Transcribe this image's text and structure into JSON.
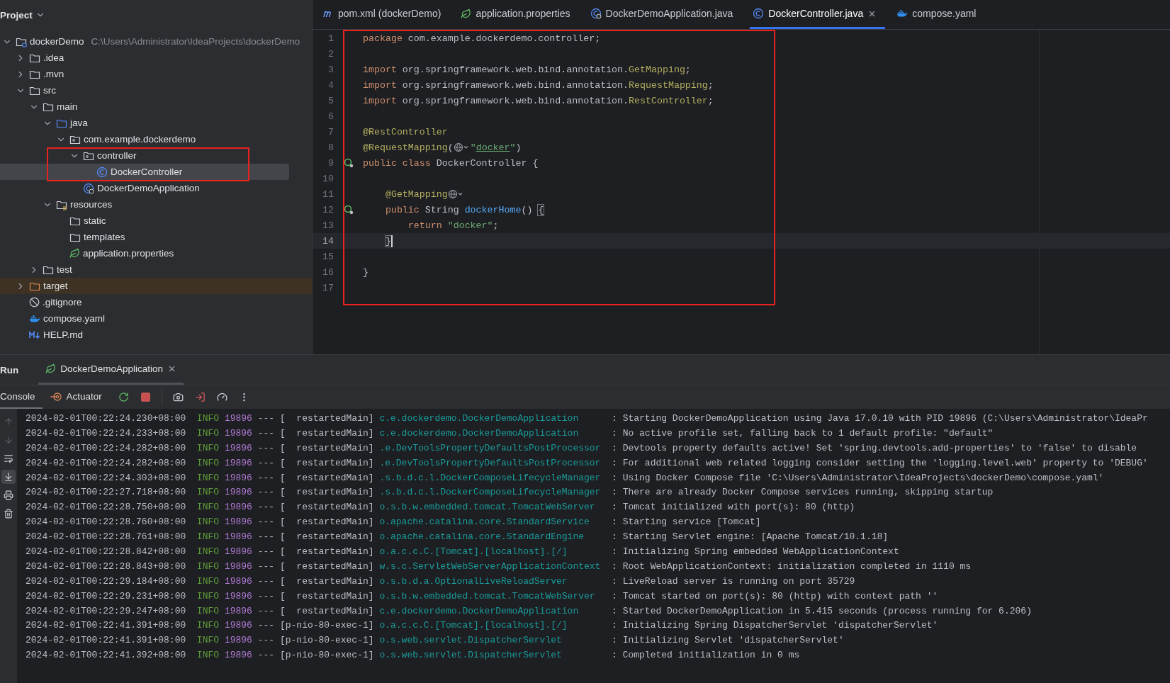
{
  "project": {
    "title": "Project",
    "tree": [
      {
        "label": "dockerDemo",
        "kind": "module",
        "path": "C:\\Users\\Administrator\\IdeaProjects\\dockerDemo",
        "expanded": true,
        "selected": false,
        "children": [
          {
            "label": ".idea",
            "kind": "folder",
            "expanded": false,
            "selected": false
          },
          {
            "label": ".mvn",
            "kind": "folder",
            "expanded": false,
            "selected": false
          },
          {
            "label": "src",
            "kind": "folder",
            "expanded": true,
            "selected": false,
            "children": [
              {
                "label": "main",
                "kind": "folder",
                "expanded": true,
                "selected": false,
                "children": [
                  {
                    "label": "java",
                    "kind": "source",
                    "expanded": true,
                    "selected": false,
                    "children": [
                      {
                        "label": "com.example.dockerdemo",
                        "kind": "package",
                        "expanded": true,
                        "selected": false,
                        "children": [
                          {
                            "label": "controller",
                            "kind": "package",
                            "expanded": true,
                            "selected": false,
                            "highlight": true,
                            "children": [
                              {
                                "label": "DockerController",
                                "kind": "class",
                                "selected": true
                              }
                            ]
                          },
                          {
                            "label": "DockerDemoApplication",
                            "kind": "spring-class",
                            "selected": false
                          }
                        ]
                      }
                    ]
                  },
                  {
                    "label": "resources",
                    "kind": "resources",
                    "expanded": true,
                    "selected": false,
                    "children": [
                      {
                        "label": "static",
                        "kind": "folder",
                        "selected": false
                      },
                      {
                        "label": "templates",
                        "kind": "folder",
                        "selected": false
                      },
                      {
                        "label": "application.properties",
                        "kind": "properties",
                        "selected": false
                      }
                    ]
                  }
                ]
              },
              {
                "label": "test",
                "kind": "folder",
                "expanded": false,
                "selected": false
              }
            ]
          },
          {
            "label": "target",
            "kind": "excluded",
            "expanded": false,
            "selected": false
          },
          {
            "label": ".gitignore",
            "kind": "ignore",
            "selected": false
          },
          {
            "label": "compose.yaml",
            "kind": "docker",
            "selected": false
          },
          {
            "label": "HELP.md",
            "kind": "markdown",
            "selected": false
          }
        ]
      }
    ]
  },
  "editor": {
    "tabs": [
      {
        "label": "pom.xml (dockerDemo)",
        "kind": "maven",
        "selected": false
      },
      {
        "label": "application.properties",
        "kind": "properties",
        "selected": false
      },
      {
        "label": "DockerDemoApplication.java",
        "kind": "spring-class",
        "selected": false
      },
      {
        "label": "DockerController.java",
        "kind": "class",
        "selected": true
      },
      {
        "label": "compose.yaml",
        "kind": "docker",
        "selected": false
      }
    ],
    "highlight": true,
    "lines": [
      {
        "number": "1",
        "current": false,
        "marker": false,
        "tokens": [
          {
            "kind": "keyword",
            "text": "package"
          },
          {
            "kind": "plain",
            "text": " com.example.dockerdemo.controller;"
          }
        ]
      },
      {
        "number": "2",
        "current": false,
        "marker": false
      },
      {
        "number": "3",
        "current": false,
        "marker": false,
        "tokens": [
          {
            "kind": "keyword",
            "text": "import"
          },
          {
            "kind": "plain",
            "text": " org.springframework.web.bind.annotation."
          },
          {
            "kind": "annotation",
            "text": "GetMapping"
          },
          {
            "kind": "plain",
            "text": ";"
          }
        ]
      },
      {
        "number": "4",
        "current": false,
        "marker": false,
        "tokens": [
          {
            "kind": "keyword",
            "text": "import"
          },
          {
            "kind": "plain",
            "text": " org.springframework.web.bind.annotation."
          },
          {
            "kind": "annotation",
            "text": "RequestMapping"
          },
          {
            "kind": "plain",
            "text": ";"
          }
        ]
      },
      {
        "number": "5",
        "current": false,
        "marker": false,
        "tokens": [
          {
            "kind": "keyword",
            "text": "import"
          },
          {
            "kind": "plain",
            "text": " org.springframework.web.bind.annotation."
          },
          {
            "kind": "annotation",
            "text": "RestController"
          },
          {
            "kind": "plain",
            "text": ";"
          }
        ]
      },
      {
        "number": "6",
        "current": false,
        "marker": false
      },
      {
        "number": "7",
        "current": false,
        "marker": false,
        "tokens": [
          {
            "kind": "annotation",
            "text": "@RestController"
          }
        ]
      },
      {
        "number": "8",
        "current": false,
        "marker": false,
        "tokens": [
          {
            "kind": "annotation",
            "text": "@RequestMapping"
          },
          {
            "kind": "plain",
            "text": "("
          },
          {
            "kind": "inlay"
          },
          {
            "kind": "string",
            "text": "\""
          },
          {
            "kind": "link",
            "text": "docker"
          },
          {
            "kind": "string",
            "text": "\""
          },
          {
            "kind": "plain",
            "text": ")"
          }
        ]
      },
      {
        "number": "9",
        "current": false,
        "marker": true,
        "tokens": [
          {
            "kind": "keyword",
            "text": "public class"
          },
          {
            "kind": "plain",
            "text": " DockerController {"
          }
        ]
      },
      {
        "number": "10",
        "current": false,
        "marker": false
      },
      {
        "number": "11",
        "current": false,
        "marker": false,
        "tokens": [
          {
            "kind": "annotation",
            "text": "    @GetMapping"
          },
          {
            "kind": "inlay"
          }
        ]
      },
      {
        "number": "12",
        "current": false,
        "marker": true,
        "tokens": [
          {
            "kind": "keyword",
            "text": "    public"
          },
          {
            "kind": "plain",
            "text": " String "
          },
          {
            "kind": "method",
            "text": "dockerHome"
          },
          {
            "kind": "plain",
            "text": "() "
          },
          {
            "kind": "brace",
            "text": "{"
          }
        ]
      },
      {
        "number": "13",
        "current": false,
        "marker": false,
        "tokens": [
          {
            "kind": "keyword",
            "text": "        return"
          },
          {
            "kind": "string",
            "text": " \"docker\""
          },
          {
            "kind": "plain",
            "text": ";"
          }
        ]
      },
      {
        "number": "14",
        "current": true,
        "marker": false,
        "tokens": [
          {
            "kind": "brace",
            "text": "    }"
          }
        ]
      },
      {
        "number": "15",
        "current": false,
        "marker": false
      },
      {
        "number": "16",
        "current": false,
        "marker": false,
        "tokens": [
          {
            "kind": "plain",
            "text": "}"
          }
        ]
      },
      {
        "number": "17",
        "current": false,
        "marker": false
      }
    ]
  },
  "run": {
    "title": "Run",
    "tabs": [
      {
        "label": "DockerDemoApplication",
        "selected": true
      }
    ],
    "toolbar_tabs": [
      {
        "label": "Console",
        "kind": "plain",
        "selected": true
      },
      {
        "label": "Actuator",
        "kind": "actuator",
        "selected": false
      }
    ],
    "console": {
      "lines": [
        {
          "time": "2024-02-01T00:22:24.230+08:00",
          "level": "INFO",
          "pid": "19896",
          "separator": "---",
          "thread": "[  restartedMain]",
          "logger": "c.e.dockerdemo.DockerDemoApplication",
          "message": ": Starting DockerDemoApplication using Java 17.0.10 with PID 19896 (C:\\Users\\Administrator\\IdeaPr"
        },
        {
          "time": "2024-02-01T00:22:24.233+08:00",
          "level": "INFO",
          "pid": "19896",
          "separator": "---",
          "thread": "[  restartedMain]",
          "logger": "c.e.dockerdemo.DockerDemoApplication",
          "message": ": No active profile set, falling back to 1 default profile: \"default\""
        },
        {
          "time": "2024-02-01T00:22:24.282+08:00",
          "level": "INFO",
          "pid": "19896",
          "separator": "---",
          "thread": "[  restartedMain]",
          "logger": ".e.DevToolsPropertyDefaultsPostProcessor",
          "message": ": Devtools property defaults active! Set 'spring.devtools.add-properties' to 'false' to disable"
        },
        {
          "time": "2024-02-01T00:22:24.282+08:00",
          "level": "INFO",
          "pid": "19896",
          "separator": "---",
          "thread": "[  restartedMain]",
          "logger": ".e.DevToolsPropertyDefaultsPostProcessor",
          "message": ": For additional web related logging consider setting the 'logging.level.web' property to 'DEBUG'"
        },
        {
          "time": "2024-02-01T00:22:24.303+08:00",
          "level": "INFO",
          "pid": "19896",
          "separator": "---",
          "thread": "[  restartedMain]",
          "logger": ".s.b.d.c.l.DockerComposeLifecycleManager",
          "message": ": Using Docker Compose file 'C:\\Users\\Administrator\\IdeaProjects\\dockerDemo\\compose.yaml'"
        },
        {
          "time": "2024-02-01T00:22:27.718+08:00",
          "level": "INFO",
          "pid": "19896",
          "separator": "---",
          "thread": "[  restartedMain]",
          "logger": ".s.b.d.c.l.DockerComposeLifecycleManager",
          "message": ": There are already Docker Compose services running, skipping startup"
        },
        {
          "time": "2024-02-01T00:22:28.750+08:00",
          "level": "INFO",
          "pid": "19896",
          "separator": "---",
          "thread": "[  restartedMain]",
          "logger": "o.s.b.w.embedded.tomcat.TomcatWebServer",
          "message": ": Tomcat initialized with port(s): 80 (http)"
        },
        {
          "time": "2024-02-01T00:22:28.760+08:00",
          "level": "INFO",
          "pid": "19896",
          "separator": "---",
          "thread": "[  restartedMain]",
          "logger": "o.apache.catalina.core.StandardService",
          "message": ": Starting service [Tomcat]"
        },
        {
          "time": "2024-02-01T00:22:28.761+08:00",
          "level": "INFO",
          "pid": "19896",
          "separator": "---",
          "thread": "[  restartedMain]",
          "logger": "o.apache.catalina.core.StandardEngine",
          "message": ": Starting Servlet engine: [Apache Tomcat/10.1.18]"
        },
        {
          "time": "2024-02-01T00:22:28.842+08:00",
          "level": "INFO",
          "pid": "19896",
          "separator": "---",
          "thread": "[  restartedMain]",
          "logger": "o.a.c.c.C.[Tomcat].[localhost].[/]",
          "message": ": Initializing Spring embedded WebApplicationContext"
        },
        {
          "time": "2024-02-01T00:22:28.843+08:00",
          "level": "INFO",
          "pid": "19896",
          "separator": "---",
          "thread": "[  restartedMain]",
          "logger": "w.s.c.ServletWebServerApplicationContext",
          "message": ": Root WebApplicationContext: initialization completed in 1110 ms"
        },
        {
          "time": "2024-02-01T00:22:29.184+08:00",
          "level": "INFO",
          "pid": "19896",
          "separator": "---",
          "thread": "[  restartedMain]",
          "logger": "o.s.b.d.a.OptionalLiveReloadServer",
          "message": ": LiveReload server is running on port 35729"
        },
        {
          "time": "2024-02-01T00:22:29.231+08:00",
          "level": "INFO",
          "pid": "19896",
          "separator": "---",
          "thread": "[  restartedMain]",
          "logger": "o.s.b.w.embedded.tomcat.TomcatWebServer",
          "message": ": Tomcat started on port(s): 80 (http) with context path ''"
        },
        {
          "time": "2024-02-01T00:22:29.247+08:00",
          "level": "INFO",
          "pid": "19896",
          "separator": "---",
          "thread": "[  restartedMain]",
          "logger": "c.e.dockerdemo.DockerDemoApplication",
          "message": ": Started DockerDemoApplication in 5.415 seconds (process running for 6.206)"
        },
        {
          "time": "2024-02-01T00:22:41.391+08:00",
          "level": "INFO",
          "pid": "19896",
          "separator": "---",
          "thread": "[p-nio-80-exec-1]",
          "logger": "o.a.c.c.C.[Tomcat].[localhost].[/]",
          "message": ": Initializing Spring DispatcherServlet 'dispatcherServlet'"
        },
        {
          "time": "2024-02-01T00:22:41.391+08:00",
          "level": "INFO",
          "pid": "19896",
          "separator": "---",
          "thread": "[p-nio-80-exec-1]",
          "logger": "o.s.web.servlet.DispatcherServlet",
          "message": ": Initializing Servlet 'dispatcherServlet'"
        },
        {
          "time": "2024-02-01T00:22:41.392+08:00",
          "level": "INFO",
          "pid": "19896",
          "separator": "---",
          "thread": "[p-nio-80-exec-1]",
          "logger": "o.s.web.servlet.DispatcherServlet",
          "message": ": Completed initialization in 0 ms"
        }
      ]
    }
  }
}
